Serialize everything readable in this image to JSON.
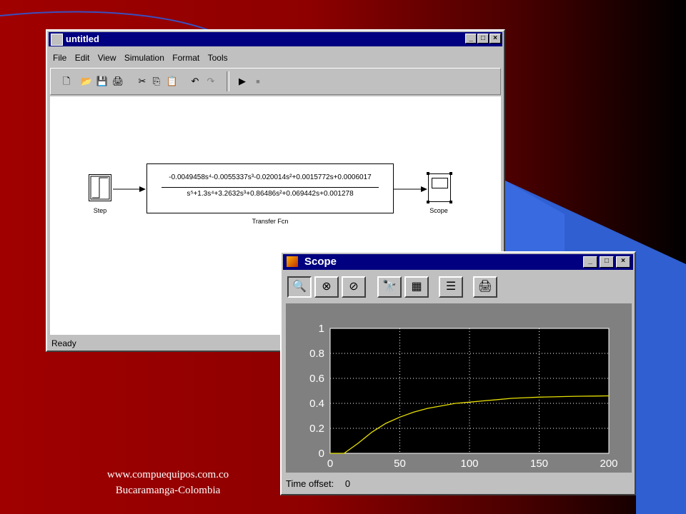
{
  "simulink": {
    "title": "untitled",
    "menu": [
      "File",
      "Edit",
      "View",
      "Simulation",
      "Format",
      "Tools"
    ],
    "toolbar_icons": [
      "new-icon",
      "open-icon",
      "save-icon",
      "print-icon",
      "cut-icon",
      "copy-icon",
      "paste-icon",
      "undo-icon",
      "redo-icon",
      "play-icon",
      "stop-icon"
    ],
    "status": "Ready",
    "blocks": {
      "step_label": "Step",
      "tf_numerator": "-0.0049458s⁴-0.0055337s³-0.020014s²+0.0015772s+0.0006017",
      "tf_denominator": "s⁵+1.3s⁴+3.2632s³+0.86486s²+0.069442s+0.001278",
      "tf_label": "Transfer Fcn",
      "scope_label": "Scope"
    }
  },
  "scope": {
    "title": "Scope",
    "toolbar_icons": [
      "zoom-icon",
      "zoom-x-icon",
      "zoom-y-icon",
      "autoscale-icon",
      "save-axes-icon",
      "properties-icon",
      "print-icon"
    ],
    "time_offset_label": "Time offset:",
    "time_offset_value": "0"
  },
  "footer": {
    "line1": "www.compuequipos.com.co",
    "line2": "Bucaramanga-Colombia"
  },
  "colors": {
    "trace": "#e8e000",
    "plot_bg": "#000000",
    "titlebar": "#000080"
  },
  "chart_data": {
    "type": "line",
    "xlim": [
      0,
      200
    ],
    "ylim": [
      0,
      1
    ],
    "xticks": [
      0,
      50,
      100,
      150,
      200
    ],
    "yticks": [
      0,
      0.2,
      0.4,
      0.6,
      0.8,
      1
    ],
    "xticklabels": [
      "0",
      "50",
      "100",
      "150",
      "200"
    ],
    "yticklabels": [
      "0",
      "0.2",
      "0.4",
      "0.6",
      "0.8",
      "1"
    ],
    "grid": true,
    "series": [
      {
        "x": [
          0,
          10,
          20,
          30,
          40,
          50,
          60,
          70,
          80,
          90,
          100,
          110,
          120,
          130,
          140,
          150,
          160,
          170,
          180,
          190,
          200
        ],
        "y": [
          0,
          0,
          0.08,
          0.17,
          0.24,
          0.29,
          0.33,
          0.36,
          0.38,
          0.4,
          0.41,
          0.42,
          0.43,
          0.44,
          0.445,
          0.45,
          0.452,
          0.455,
          0.457,
          0.458,
          0.46
        ]
      }
    ]
  }
}
